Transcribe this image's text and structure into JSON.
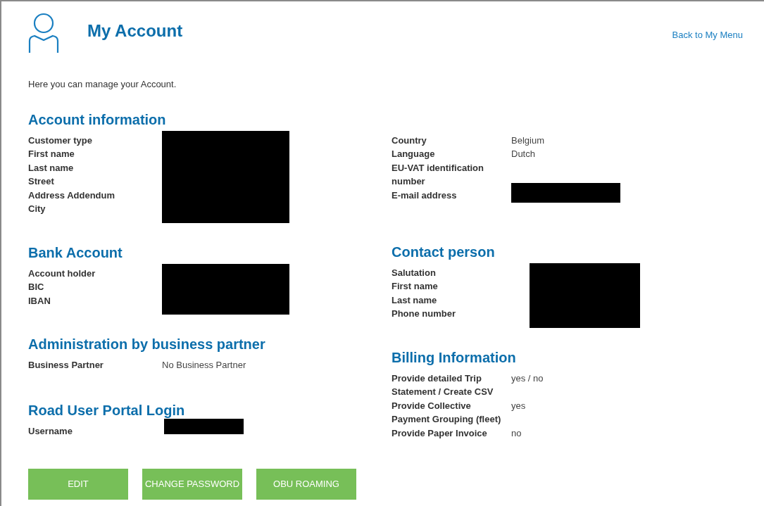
{
  "title": "My Account",
  "back_link": "Back to My Menu",
  "intro": "Here you can manage your Account.",
  "left_column": [
    {
      "heading": "Account information",
      "redacted": true,
      "rows": [
        {
          "label": "Customer type"
        },
        {
          "label": "First name"
        },
        {
          "label": "Last name"
        },
        {
          "label": "Street"
        },
        {
          "label": "Address Addendum"
        },
        {
          "label": "City"
        }
      ]
    },
    {
      "heading": "Bank Account",
      "redacted": true,
      "rows": [
        {
          "label": "Account holder"
        },
        {
          "label": "BIC"
        },
        {
          "label": "IBAN"
        }
      ]
    },
    {
      "heading": "Administration by business partner",
      "rows": [
        {
          "label": "Business Partner",
          "value": "No Business Partner"
        }
      ]
    },
    {
      "heading": "Road User Portal Login",
      "rows": [
        {
          "label": "Username",
          "redacted": true
        }
      ]
    }
  ],
  "right_column": [
    {
      "rows": [
        {
          "label": "Country",
          "value": "Belgium"
        },
        {
          "label": "Language",
          "value": "Dutch"
        },
        {
          "label": "EU-VAT identification number"
        },
        {
          "label": "E-mail address",
          "redacted": true
        }
      ]
    },
    {
      "heading": "Contact person",
      "redacted": true,
      "rows": [
        {
          "label": "Salutation"
        },
        {
          "label": "First name"
        },
        {
          "label": "Last name"
        },
        {
          "label": "Phone number"
        }
      ]
    },
    {
      "heading": "Billing Information",
      "rows": [
        {
          "label": "Provide detailed Trip Statement / Create CSV",
          "value": "yes / no"
        },
        {
          "label": "Provide Collective Payment Grouping (fleet)",
          "value": "yes"
        },
        {
          "label": "Provide Paper Invoice",
          "value": "no"
        }
      ]
    }
  ],
  "buttons": [
    "EDIT",
    "CHANGE PASSWORD",
    "OBU ROAMING"
  ]
}
